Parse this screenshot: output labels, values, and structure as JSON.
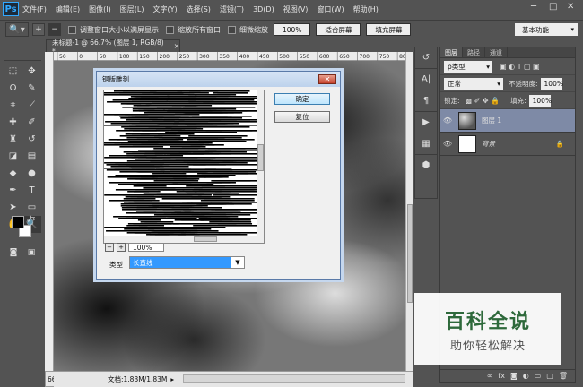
{
  "app": {
    "logo": "Ps"
  },
  "menu": [
    "文件(F)",
    "编辑(E)",
    "图像(I)",
    "图层(L)",
    "文字(Y)",
    "选择(S)",
    "滤镜(T)",
    "3D(D)",
    "视图(V)",
    "窗口(W)",
    "帮助(H)"
  ],
  "window_controls": {
    "minimize": "─",
    "maximize": "□",
    "close": "✕"
  },
  "options_bar": {
    "tool_glyph": "🔍▾",
    "check_resize": "调整窗口大小以满屏显示",
    "check_zoom_all": "缩放所有窗口",
    "check_scrubby": "细微缩放",
    "btn_100": "100%",
    "btn_fit": "适合屏幕",
    "btn_fill": "填充屏幕",
    "workspace": "基本功能"
  },
  "document": {
    "tab_title": "未标题-1 @ 66.7% (图层 1, RGB/8) *",
    "ruler_ticks": [
      "50",
      "0",
      "50",
      "100",
      "150",
      "200",
      "250",
      "300",
      "350",
      "400",
      "450",
      "500",
      "550",
      "600",
      "650",
      "700",
      "750",
      "800"
    ],
    "zoom": "66.67%",
    "doc_info": "文档:1.83M/1.83M"
  },
  "dialog": {
    "title": "铜版雕刻",
    "ok": "确定",
    "reset": "复位",
    "zoom": "100%",
    "type_label": "类型",
    "type_value": "长直线"
  },
  "layers_panel": {
    "tabs": [
      "图层",
      "路径",
      "通道"
    ],
    "filter_kind": "ρ类型",
    "blend_mode": "正常",
    "opacity_label": "不透明度:",
    "opacity": "100%",
    "lock_label": "锁定:",
    "fill_label": "填充:",
    "fill": "100%",
    "layers": [
      {
        "name": "图层 1",
        "selected": true
      },
      {
        "name": "背景",
        "selected": false
      }
    ]
  },
  "watermark": {
    "big": "百科全说",
    "small": "助你轻松解决"
  }
}
